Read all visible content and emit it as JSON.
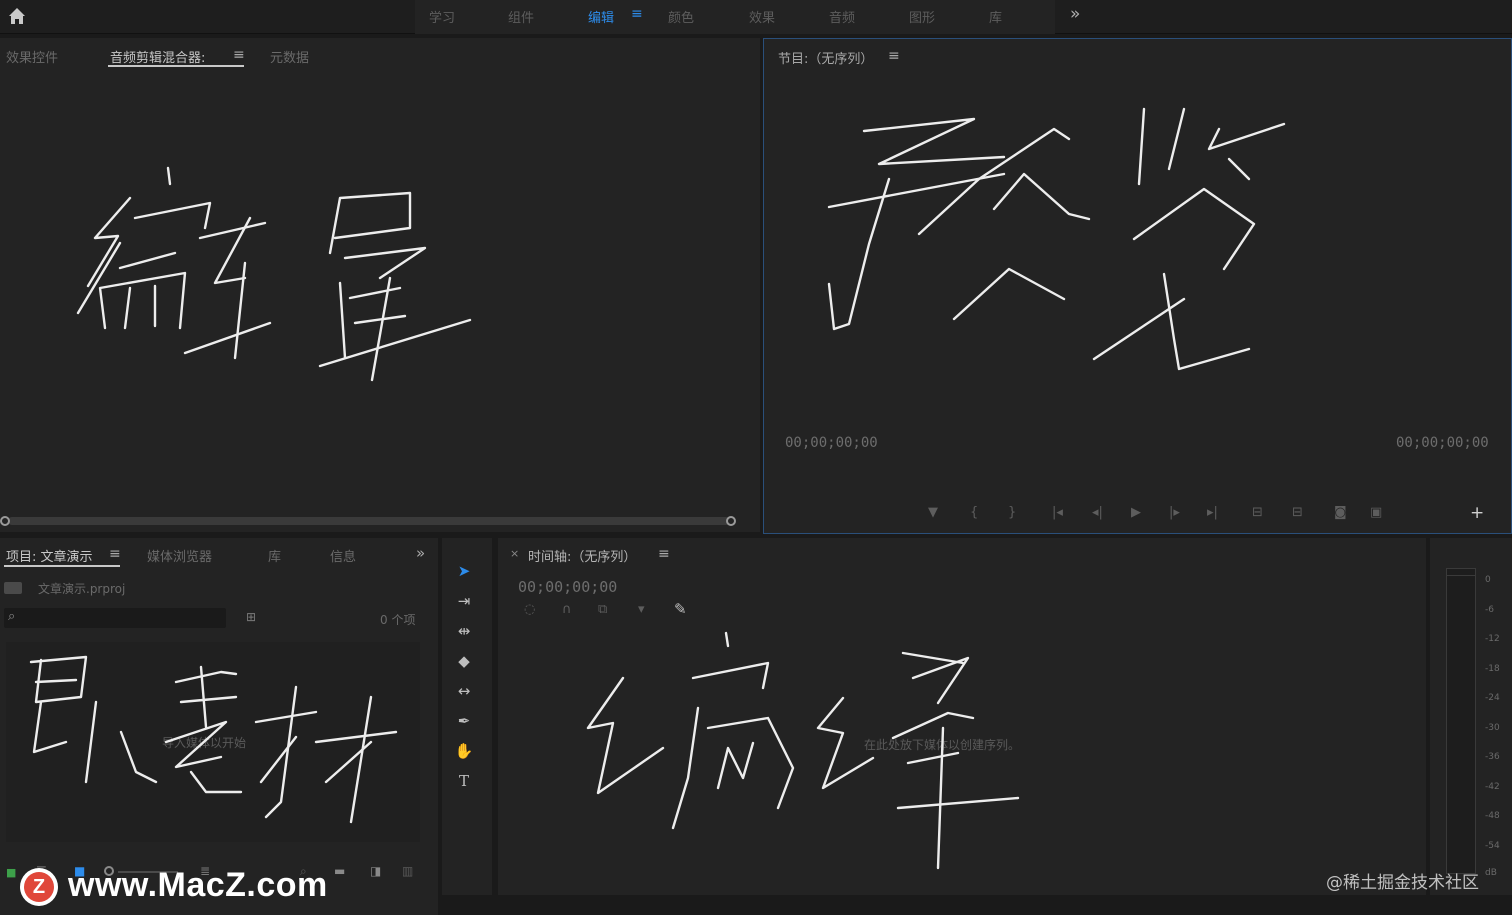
{
  "workspace_tabs": [
    "学习",
    "组件",
    "编辑",
    "颜色",
    "效果",
    "音频",
    "图形",
    "库"
  ],
  "active_workspace": "编辑",
  "overflow_glyph": "»",
  "top_left_panel": {
    "tabs": [
      "效果控件",
      "音频剪辑混合器:",
      "元数据"
    ],
    "active_tab": "音频剪辑混合器:",
    "handwritten_note": "编辑"
  },
  "program_monitor": {
    "title": "节目:（无序列）",
    "timecode_left": "00;00;00;00",
    "timecode_right": "00;00;00;00",
    "handwritten_note": "预览"
  },
  "project_panel": {
    "tabs": [
      "项目: 文章演示",
      "媒体浏览器",
      "库",
      "信息"
    ],
    "project_file": "文章演示.prproj",
    "search_placeholder": "",
    "item_count": "0 个项",
    "empty_hint": "导入媒体以开始",
    "handwritten_note": "导入素材"
  },
  "timeline_panel": {
    "title": "时间轴:（无序列）",
    "timecode": "00;00;00;00",
    "empty_hint": "在此处放下媒体以创建序列。",
    "handwritten_note": "编辑"
  },
  "audio_meter": {
    "scale": [
      "0",
      "-6",
      "-12",
      "-18",
      "-24",
      "-30",
      "-36",
      "-42",
      "-48",
      "-54",
      "dB"
    ]
  },
  "watermark_left": "www.MacZ.com",
  "watermark_right": "@稀土掘金技术社区",
  "colors": {
    "accent": "#2d8ceb",
    "panel_bg": "#232323",
    "app_bg": "#1a1a1a"
  }
}
